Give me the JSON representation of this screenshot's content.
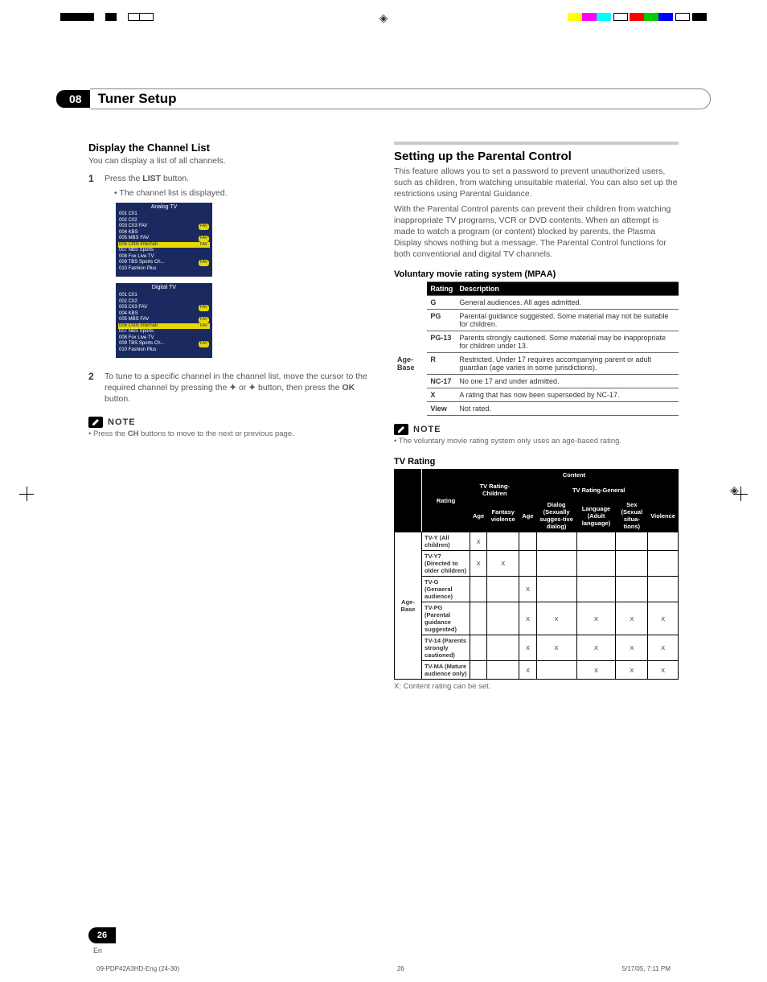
{
  "chapter": {
    "num": "08",
    "title": "Tuner Setup"
  },
  "left": {
    "h3": "Display the Channel List",
    "intro": "You can display a list of all channels.",
    "step1_num": "1",
    "step1_a": "Press the ",
    "step1_b": "LIST",
    "step1_c": " button.",
    "step1_bullet": "• The channel list is displayed.",
    "analog_title": "Analog TV",
    "digital_title": "Digital TV",
    "channels": [
      {
        "t": "001 C01",
        "fav": false,
        "hl": false
      },
      {
        "t": "002 C02",
        "fav": false,
        "hl": false
      },
      {
        "t": "003 C03 FAV",
        "fav": true,
        "hl": false
      },
      {
        "t": "004 KBS",
        "fav": false,
        "hl": false
      },
      {
        "t": "005 MBS FAV",
        "fav": true,
        "hl": false
      },
      {
        "t": "006 CNN Internati",
        "fav": true,
        "hl": true
      },
      {
        "t": "007 NBS Sports",
        "fav": false,
        "hl": false
      },
      {
        "t": "008 Fox Live TV",
        "fav": false,
        "hl": false
      },
      {
        "t": "009 TBS Sports Ch...",
        "fav": true,
        "hl": false
      },
      {
        "t": "010 Fashion Plus",
        "fav": false,
        "hl": false
      }
    ],
    "step2_num": "2",
    "step2_a": "To tune to a specific channel in the channel list, move the cursor to the required channel by pressing the ",
    "step2_b": " or ",
    "step2_c": " button, then press the ",
    "step2_ok": "OK",
    "step2_d": " button.",
    "note_label": "NOTE",
    "note_text": "• Press the CH buttons to move to the next or previous page.",
    "note_bold": "CH"
  },
  "right": {
    "h2": "Setting up the Parental Control",
    "p1": "This feature allows you to set a password to prevent unauthorized users, such as children, from watching unsuitable material. You can also set up the restrictions using Parental Guidance.",
    "p2": "With the Parental Control parents can prevent their children from watching inappropriate TV programs, VCR or DVD contents. When an attempt is made to watch a program (or content) blocked by parents, the Plasma Display shows nothing but a message. The Parental Control functions for both conventional and digital TV channels.",
    "mpaa_h": "Voluntary movie rating system (MPAA)",
    "mpaa_th1": "Rating",
    "mpaa_th2": "Description",
    "mpaa_side": "Age-Base",
    "mpaa_rows": [
      {
        "r": "G",
        "d": "General audiences. All ages admitted."
      },
      {
        "r": "PG",
        "d": "Parental guidance suggested. Some material may not be suitable for children."
      },
      {
        "r": "PG-13",
        "d": "Parents strongly cautioned. Some material may be inappropriate for children under 13."
      },
      {
        "r": "R",
        "d": "Restricted. Under 17 requires accompanying parent or adult guardian (age varies in some jurisdictions)."
      },
      {
        "r": "NC-17",
        "d": "No one 17 and under admitted."
      },
      {
        "r": "X",
        "d": "A rating that has now been superseded by NC-17."
      },
      {
        "r": "View",
        "d": "Not rated."
      }
    ],
    "note_label": "NOTE",
    "note_text": "• The voluntary movie rating system only uses an age-based rating.",
    "tv_h": "TV Rating",
    "tv_content": "Content",
    "tv_children": "TV Rating-Children",
    "tv_general": "TV Rating-General",
    "tv_rating_h": "Rating",
    "tv_cols": [
      "Age",
      "Fantasy violence",
      "Age",
      "Dialog (Sexually sugges-tive dialog)",
      "Language (Adult language)",
      "Sex (Sexual situa-tions)",
      "Violence"
    ],
    "tv_side": "Age-Base",
    "tv_rows": [
      {
        "lab": "TV-Y (All children)",
        "c": [
          "X",
          "",
          "",
          "",
          "",
          "",
          ""
        ]
      },
      {
        "lab": "TV-Y7 (Directed to older children)",
        "c": [
          "X",
          "X",
          "",
          "",
          "",
          "",
          ""
        ]
      },
      {
        "lab": "TV-G (Genaeral audience)",
        "c": [
          "",
          "",
          "X",
          "",
          "",
          "",
          ""
        ]
      },
      {
        "lab": "TV-PG (Parental guidance suggested)",
        "c": [
          "",
          "",
          "X",
          "X",
          "X",
          "X",
          "X"
        ]
      },
      {
        "lab": "TV-14 (Parents strongly cautioned)",
        "c": [
          "",
          "",
          "X",
          "X",
          "X",
          "X",
          "X"
        ]
      },
      {
        "lab": "TV-MA (Mature audience only)",
        "c": [
          "",
          "",
          "X",
          "",
          "X",
          "X",
          "X"
        ]
      }
    ],
    "tv_foot": "X: Content rating can be set."
  },
  "page": {
    "num": "26",
    "lang": "En"
  },
  "footer": {
    "left": "09-PDP42A3HD-Eng (24-30)",
    "mid": "26",
    "right": "5/17/05, 7:11 PM"
  }
}
